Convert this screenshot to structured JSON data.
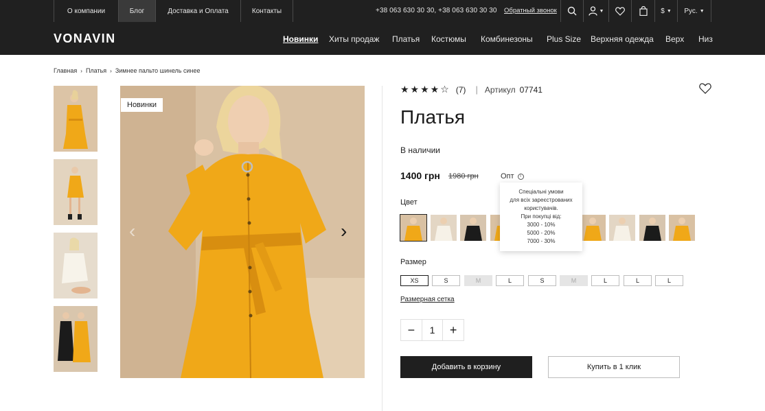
{
  "topbar": {
    "links": [
      "О компании",
      "Блог",
      "Доставка и Оплата",
      "Контакты"
    ],
    "phones": "+38 063 630 30 30,  +38 063 630 30 30",
    "callback": "Обратный звонок",
    "currency": "$",
    "language": "Рус."
  },
  "header": {
    "logo": "VONAVIN",
    "nav": [
      "Новинки",
      "Хиты продаж",
      "Платья",
      "Костюмы",
      "Комбинезоны",
      "Plus Size",
      "Верхняя одежда",
      "Верх",
      "Низ"
    ]
  },
  "breadcrumb": [
    "Главная",
    "Платья",
    "Зимнее пальто шинель синее"
  ],
  "gallery": {
    "badge": "Новинки",
    "prev_icon": "‹",
    "next_icon": "›"
  },
  "product": {
    "stars": "★★★★☆",
    "rating": 4,
    "review_count": "(7)",
    "sku_label": "Артикул",
    "sku": "07741",
    "title": "Платья",
    "stock": "В наличии",
    "price": "1400 грн",
    "old_price": "1980 грн",
    "wholesale_label": "Опт",
    "wholesale_tooltip": [
      "Спеціальні умови",
      "для всіх зареєстрованих",
      "користувачів.",
      "При покупці від:",
      "3000 - 10%",
      "5000 - 20%",
      "7000 - 30%"
    ],
    "color_label": "Цвет",
    "color_swatches": [
      "yellow",
      "white",
      "black",
      "yellow",
      "",
      "",
      "yellow",
      "white",
      "black",
      "yellow"
    ],
    "size_label": "Размер",
    "sizes": [
      {
        "label": "XS",
        "state": "selected"
      },
      {
        "label": "S",
        "state": "available"
      },
      {
        "label": "M",
        "state": "disabled"
      },
      {
        "label": "L",
        "state": "available"
      },
      {
        "label": "S",
        "state": "available"
      },
      {
        "label": "M",
        "state": "disabled"
      },
      {
        "label": "L",
        "state": "available"
      },
      {
        "label": "L",
        "state": "available"
      },
      {
        "label": "L",
        "state": "available"
      }
    ],
    "size_grid": "Размерная сетка",
    "quantity": "1",
    "minus": "−",
    "plus": "+",
    "add_to_cart": "Добавить в корзину",
    "buy_one_click": "Купить в 1 клик"
  },
  "colors": {
    "header_bg": "#202020",
    "dress": "#f0a818",
    "backdrop": "#d9c1a3"
  }
}
